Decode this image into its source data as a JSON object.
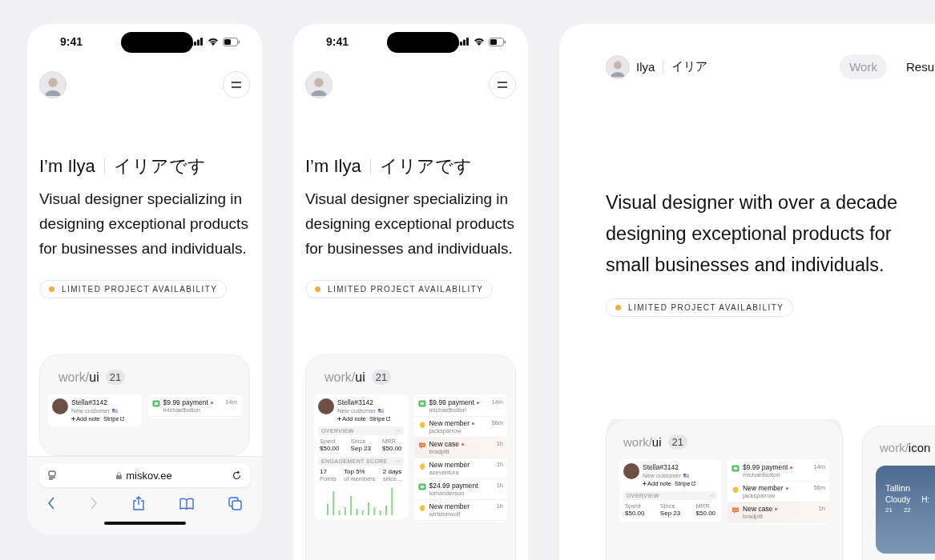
{
  "screens": [
    {
      "kind": "phone",
      "status": {
        "time": "9:41"
      },
      "intro": {
        "name": "I’m Ilya",
        "native": "イリアです"
      },
      "bio": "Visual designer specializing in designing exceptional products for businesses and individuals.",
      "badge": "LIMITED PROJECT AVAILABILITY",
      "cards": [
        {
          "kind": "ui",
          "prefix": "work/",
          "name": "ui",
          "count": "21",
          "profile": {
            "name": "Stella#3142",
            "subtitle": "New customer",
            "actions": [
              {
                "kind": "add",
                "label": "Add note"
              },
              {
                "kind": "link",
                "label": "Stripe"
              }
            ]
          },
          "feed": [
            {
              "kind": "payment",
              "title": "$9.99 payment",
              "user": "michaelbolton",
              "time": "14m",
              "unread": true,
              "selected": false
            }
          ]
        }
      ],
      "browser": {
        "url": "miskov.ee"
      }
    },
    {
      "kind": "phone",
      "status": {
        "time": "9:41"
      },
      "intro": {
        "name": "I’m Ilya",
        "native": "イリアです"
      },
      "bio": "Visual designer specializing in designing exceptional products for businesses and individuals.",
      "badge": "LIMITED PROJECT AVAILABILITY",
      "cards": [
        {
          "kind": "ui",
          "prefix": "work/",
          "name": "ui",
          "count": "21",
          "profile": {
            "name": "Stella#3142",
            "subtitle": "New customer",
            "actions": [
              {
                "kind": "add",
                "label": "Add note"
              },
              {
                "kind": "link",
                "label": "Stripe"
              }
            ],
            "sections": [
              {
                "kind": "overview",
                "title": "OVERVIEW",
                "stats": [
                  {
                    "label": "Spent",
                    "value": "$50.00"
                  },
                  {
                    "label": "Since",
                    "value": "Sep 23"
                  },
                  {
                    "label": "MRR",
                    "value": "$50.00"
                  }
                ]
              },
              {
                "kind": "engagement",
                "title": "ENGAGEMENT SCORE",
                "stats": [
                  {
                    "label": "Points",
                    "value": "17"
                  },
                  {
                    "label": "of members",
                    "value": "Top 5%"
                  },
                  {
                    "label": "since...",
                    "value": "2 days"
                  }
                ]
              }
            ]
          },
          "feed": [
            {
              "kind": "payment",
              "title": "$9.99 payment",
              "user": "michaelbolton",
              "time": "14m",
              "unread": true,
              "selected": false
            },
            {
              "kind": "member",
              "title": "New member",
              "user": "jacksparrow",
              "time": "56m",
              "unread": true,
              "selected": false
            },
            {
              "kind": "case",
              "title": "New case",
              "user": "bradpitt",
              "time": "1h",
              "unread": true,
              "selected": true
            },
            {
              "kind": "member",
              "title": "New member",
              "user": "aceventura",
              "time": "1h",
              "unread": false,
              "selected": false
            },
            {
              "kind": "payment",
              "title": "$24.99 payment",
              "user": "tomanderson",
              "time": "1h",
              "unread": false,
              "selected": false
            },
            {
              "kind": "member",
              "title": "New member",
              "user": "winstonwolf",
              "time": "1h",
              "unread": false,
              "selected": false
            }
          ]
        }
      ]
    },
    {
      "kind": "desktop",
      "header": {
        "name": "Ilya",
        "native": "イリア"
      },
      "nav": [
        {
          "label": "Work",
          "selected": true
        },
        {
          "label": "Resu",
          "selected": false
        }
      ],
      "bio": "Visual designer with over a decade designing exceptional products for small businesses and individuals.",
      "badge": "LIMITED PROJECT AVAILABILITY",
      "cards": [
        {
          "kind": "ui",
          "prefix": "work/",
          "name": "ui",
          "count": "21",
          "profile": {
            "name": "Stella#3142",
            "subtitle": "New customer",
            "actions": [
              {
                "kind": "add",
                "label": "Add note"
              },
              {
                "kind": "link",
                "label": "Stripe"
              }
            ],
            "sections": [
              {
                "kind": "overview",
                "title": "OVERVIEW",
                "stats": [
                  {
                    "label": "Spent",
                    "value": "$50.00"
                  },
                  {
                    "label": "Since",
                    "value": "Sep 23"
                  },
                  {
                    "label": "MRR",
                    "value": "$50.00"
                  }
                ]
              }
            ]
          },
          "feed": [
            {
              "kind": "payment",
              "title": "$9.99 payment",
              "user": "michaelbolton",
              "time": "14m",
              "unread": true,
              "selected": false
            },
            {
              "kind": "member",
              "title": "New member",
              "user": "jacksparrow",
              "time": "56m",
              "unread": true,
              "selected": false
            },
            {
              "kind": "case",
              "title": "New case",
              "user": "bradpitt",
              "time": "1h",
              "unread": true,
              "selected": true
            }
          ]
        },
        {
          "kind": "icons",
          "prefix": "work/",
          "name": "icon",
          "weather": {
            "city": "Tallinn",
            "condition": "Cloudy",
            "high": "H:",
            "hours": [
              "21",
              "22"
            ]
          }
        }
      ]
    }
  ]
}
